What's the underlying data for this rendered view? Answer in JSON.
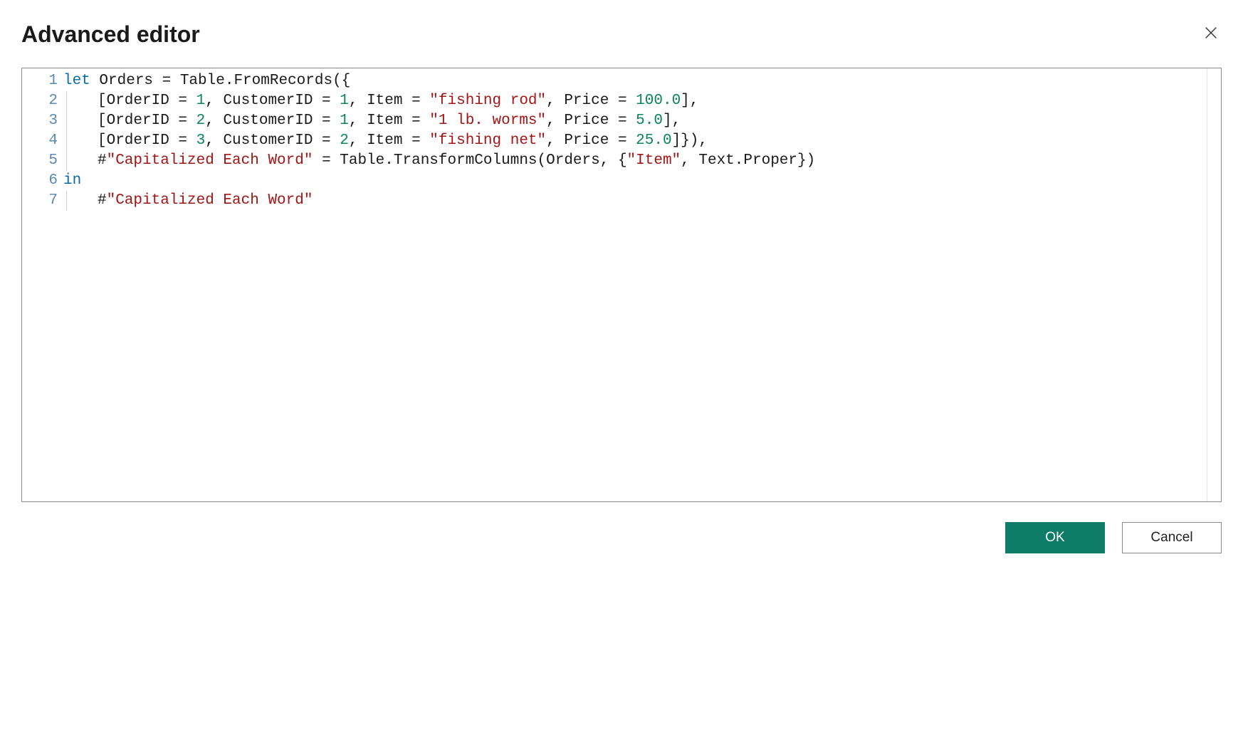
{
  "header": {
    "title": "Advanced editor"
  },
  "code": {
    "line_numbers": [
      "1",
      "2",
      "3",
      "4",
      "5",
      "6",
      "7"
    ],
    "lines": [
      [
        {
          "t": "keyword",
          "v": "let"
        },
        {
          "t": "ident",
          "v": " Orders = Table.FromRecords({"
        }
      ],
      [
        {
          "t": "ident",
          "v": "[OrderID = "
        },
        {
          "t": "number",
          "v": "1"
        },
        {
          "t": "ident",
          "v": ", CustomerID = "
        },
        {
          "t": "number",
          "v": "1"
        },
        {
          "t": "ident",
          "v": ", Item = "
        },
        {
          "t": "string",
          "v": "\"fishing rod\""
        },
        {
          "t": "ident",
          "v": ", Price = "
        },
        {
          "t": "number",
          "v": "100.0"
        },
        {
          "t": "ident",
          "v": "],"
        }
      ],
      [
        {
          "t": "ident",
          "v": "[OrderID = "
        },
        {
          "t": "number",
          "v": "2"
        },
        {
          "t": "ident",
          "v": ", CustomerID = "
        },
        {
          "t": "number",
          "v": "1"
        },
        {
          "t": "ident",
          "v": ", Item = "
        },
        {
          "t": "string",
          "v": "\"1 lb. worms\""
        },
        {
          "t": "ident",
          "v": ", Price = "
        },
        {
          "t": "number",
          "v": "5.0"
        },
        {
          "t": "ident",
          "v": "],"
        }
      ],
      [
        {
          "t": "ident",
          "v": "[OrderID = "
        },
        {
          "t": "number",
          "v": "3"
        },
        {
          "t": "ident",
          "v": ", CustomerID = "
        },
        {
          "t": "number",
          "v": "2"
        },
        {
          "t": "ident",
          "v": ", Item = "
        },
        {
          "t": "string",
          "v": "\"fishing net\""
        },
        {
          "t": "ident",
          "v": ", Price = "
        },
        {
          "t": "number",
          "v": "25.0"
        },
        {
          "t": "ident",
          "v": "]}),"
        }
      ],
      [
        {
          "t": "ident",
          "v": "#"
        },
        {
          "t": "string",
          "v": "\"Capitalized Each Word\""
        },
        {
          "t": "ident",
          "v": " = Table.TransformColumns(Orders, {"
        },
        {
          "t": "string",
          "v": "\"Item\""
        },
        {
          "t": "ident",
          "v": ", Text.Proper})"
        }
      ],
      [
        {
          "t": "keyword",
          "v": "in"
        }
      ],
      [
        {
          "t": "ident",
          "v": "#"
        },
        {
          "t": "string",
          "v": "\"Capitalized Each Word\""
        }
      ]
    ],
    "indents": [
      0,
      1,
      1,
      1,
      1,
      0,
      1
    ]
  },
  "footer": {
    "ok_label": "OK",
    "cancel_label": "Cancel"
  }
}
